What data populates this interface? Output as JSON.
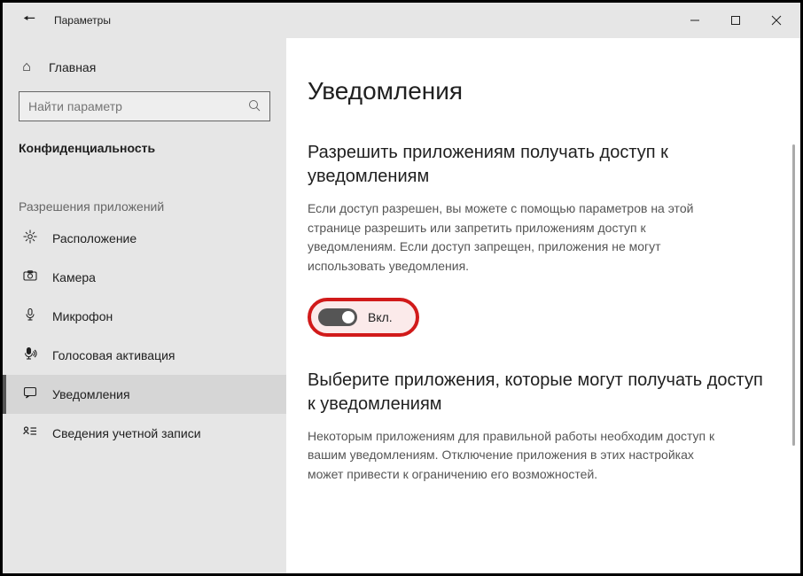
{
  "window": {
    "title": "Параметры"
  },
  "sidebar": {
    "home_label": "Главная",
    "search_placeholder": "Найти параметр",
    "group_title": "Конфиденциальность",
    "subgroup_title": "Разрешения приложений",
    "items": [
      {
        "label": "Расположение"
      },
      {
        "label": "Камера"
      },
      {
        "label": "Микрофон"
      },
      {
        "label": "Голосовая активация"
      },
      {
        "label": "Уведомления"
      },
      {
        "label": "Сведения учетной записи"
      }
    ]
  },
  "main": {
    "page_title": "Уведомления",
    "section1_heading": "Разрешить приложениям получать доступ к уведомлениям",
    "section1_desc": "Если доступ разрешен, вы можете с помощью параметров на этой странице разрешить или запретить приложениям доступ к уведомлениям. Если доступ запрещен, приложения не могут использовать уведомления.",
    "toggle_state": "on",
    "toggle_label": "Вкл.",
    "section2_heading": "Выберите приложения, которые могут получать доступ к уведомлениям",
    "section2_desc": "Некоторым приложениям для правильной работы необходим доступ к вашим уведомлениям. Отключение приложения в этих настройках может привести к ограничению его возможностей."
  },
  "highlight": {
    "color": "#d11a1a"
  }
}
